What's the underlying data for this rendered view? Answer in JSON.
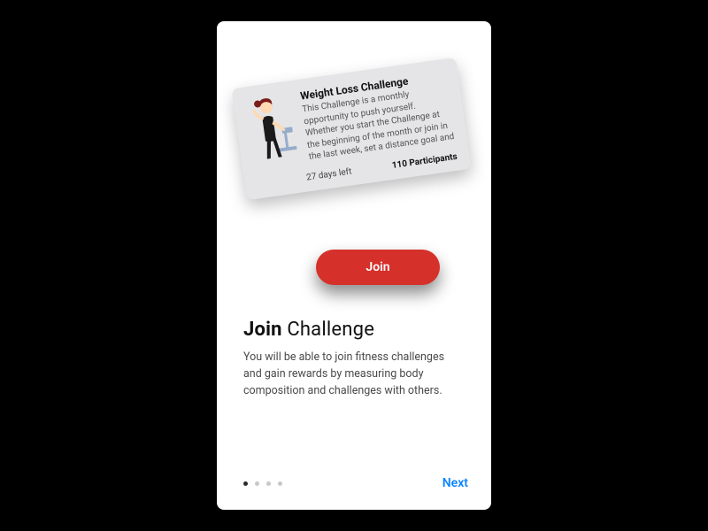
{
  "card": {
    "title": "Weight Loss Challenge",
    "description": "This Challenge is a monthly opportunity to push yourself. Whether you start the Challenge at the beginning of the month or join in the last week, set a distance goal and",
    "days_left": "27 days left",
    "participants": "110 Participants"
  },
  "join_button": "Join",
  "headline_bold": "Join",
  "headline_rest": " Challenge",
  "body": "You will be able to join fitness challenges and gain rewards by measuring body composition and challenges with others.",
  "pager": {
    "count": 4,
    "active_index": 0
  },
  "next_label": "Next",
  "colors": {
    "accent": "#d6302a",
    "link": "#0a84ff"
  }
}
